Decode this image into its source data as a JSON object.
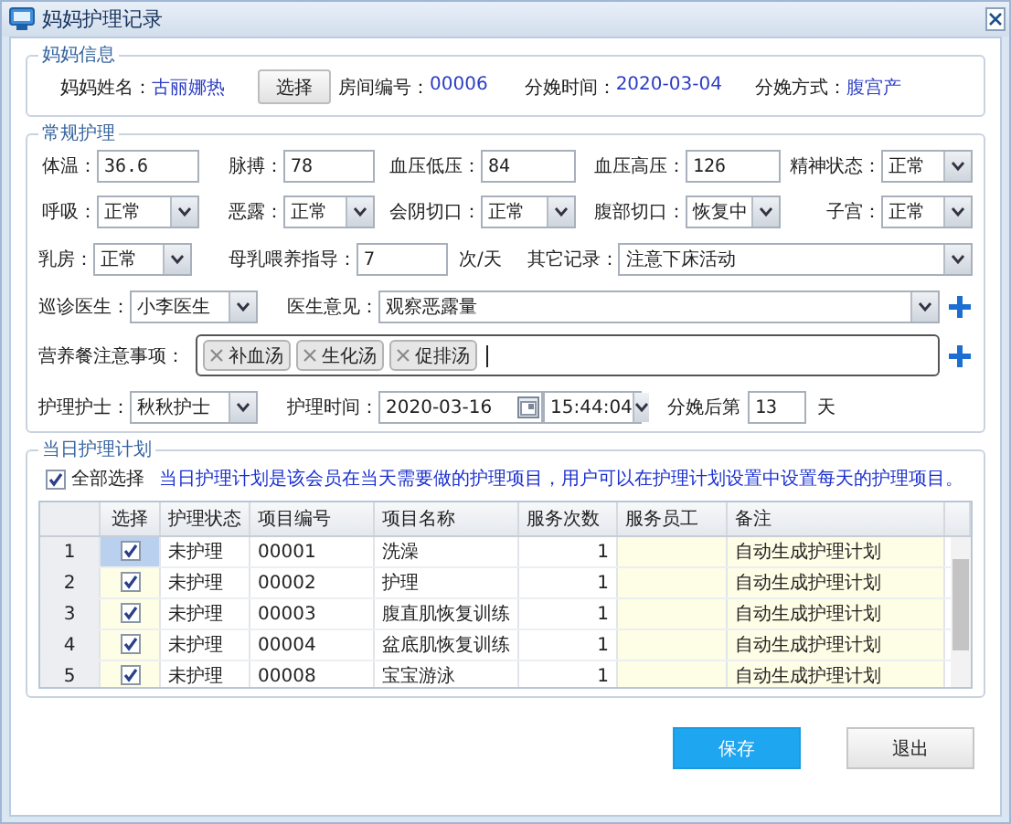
{
  "window": {
    "title": "妈妈护理记录"
  },
  "mother_info": {
    "legend": "妈妈信息",
    "name_label": "妈妈姓名：",
    "name": "古丽娜热",
    "select_button": "选择",
    "fields": [
      {
        "label": "房间编号：",
        "value": "00006"
      },
      {
        "label": "分娩时间：",
        "value": "2020-03-04"
      },
      {
        "label": "分娩方式：",
        "value": "腹宫产"
      }
    ]
  },
  "routine_care": {
    "legend": "常规护理",
    "grid": [
      {
        "kind": "text",
        "label": "体温：",
        "value": "36.6"
      },
      {
        "kind": "text",
        "label": "脉搏：",
        "value": "78"
      },
      {
        "kind": "text",
        "label": "血压低压：",
        "value": "84"
      },
      {
        "kind": "text",
        "label": "血压高压：",
        "value": "126"
      },
      {
        "kind": "select",
        "label": "精神状态：",
        "value": "正常"
      },
      {
        "kind": "select",
        "label": "呼吸：",
        "value": "正常"
      },
      {
        "kind": "select",
        "label": "恶露：",
        "value": "正常"
      },
      {
        "kind": "select",
        "label": "会阴切口：",
        "value": "正常"
      },
      {
        "kind": "select",
        "label": "腹部切口：",
        "value": "恢复中"
      },
      {
        "kind": "select",
        "label": "子宫：",
        "value": "正常"
      }
    ],
    "rows": [
      {
        "items": [
          {
            "kind": "select",
            "label": "乳房：",
            "value": "正常"
          },
          {
            "kind": "text",
            "label": "母乳喂养指导：",
            "value": "7",
            "suffix": "次/天"
          },
          {
            "kind": "select_wide",
            "label": "其它记录：",
            "value": "注意下床活动"
          }
        ]
      },
      {
        "items": [
          {
            "kind": "select",
            "label": "巡诊医生：",
            "value": "小李医生"
          },
          {
            "kind": "select_wide",
            "label": "医生意见：",
            "value": "观察恶露量"
          },
          {
            "kind": "add"
          }
        ]
      },
      {
        "items": [
          {
            "kind": "tags",
            "label": "营养餐注意事项：",
            "tags": [
              "补血汤",
              "生化汤",
              "促排汤"
            ]
          },
          {
            "kind": "add"
          }
        ]
      },
      {
        "items": [
          {
            "kind": "select",
            "label": "护理护士：",
            "value": "秋秋护士"
          },
          {
            "kind": "date",
            "label": "护理时间：",
            "value": "2020-03-16"
          },
          {
            "kind": "time",
            "value": "15:44:04"
          },
          {
            "kind": "text",
            "label": "分娩后第",
            "value": "13",
            "suffix": "天"
          }
        ]
      }
    ]
  },
  "care_plan": {
    "legend": "当日护理计划",
    "select_all": {
      "label": "全部选择",
      "checked": true
    },
    "note": "当日护理计划是该会员在当天需要做的护理项目，用户可以在护理计划设置中设置每天的护理项目。",
    "columns": [
      {
        "label": "选择",
        "kind": "check",
        "editable": true
      },
      {
        "label": "护理状态",
        "kind": "status",
        "editable": false
      },
      {
        "label": "项目编号",
        "kind": "code",
        "editable": false
      },
      {
        "label": "项目名称",
        "kind": "name",
        "editable": false
      },
      {
        "label": "服务次数",
        "kind": "count",
        "editable": false
      },
      {
        "label": "服务员工",
        "kind": "staff",
        "editable": true
      },
      {
        "label": "备注",
        "kind": "note",
        "editable": true
      }
    ],
    "rows": [
      {
        "number": "1",
        "selected": true,
        "checked": true,
        "status": "未护理",
        "code": "00001",
        "name": "洗澡",
        "count": "1",
        "note": "自动生成护理计划"
      },
      {
        "number": "2",
        "selected": false,
        "checked": true,
        "status": "未护理",
        "code": "00002",
        "name": "护理",
        "count": "1",
        "note": "自动生成护理计划"
      },
      {
        "number": "3",
        "selected": false,
        "checked": true,
        "status": "未护理",
        "code": "00003",
        "name": "腹直肌恢复训练",
        "count": "1",
        "note": "自动生成护理计划"
      },
      {
        "number": "4",
        "selected": false,
        "checked": true,
        "status": "未护理",
        "code": "00004",
        "name": "盆底肌恢复训练",
        "count": "1",
        "note": "自动生成护理计划"
      },
      {
        "number": "5",
        "selected": false,
        "checked": true,
        "status": "未护理",
        "code": "00008",
        "name": "宝宝游泳",
        "count": "1",
        "note": "自动生成护理计划"
      }
    ]
  },
  "buttons": [
    {
      "label": "保存",
      "primary": true
    },
    {
      "label": "退出",
      "primary": false
    }
  ]
}
